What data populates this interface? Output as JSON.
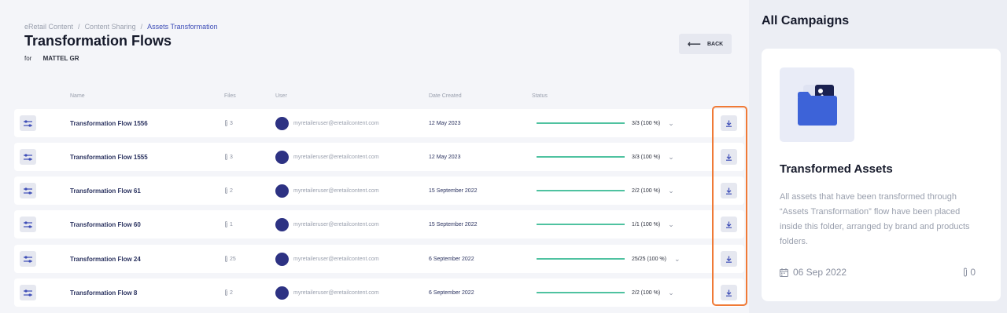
{
  "breadcrumb": [
    "eRetail Content",
    "Content Sharing",
    "Assets Transformation"
  ],
  "page_title": "Transformation Flows",
  "subtitle": {
    "prefix": "for",
    "brand": "MATTEL GR"
  },
  "back_label": "BACK",
  "table_headers": {
    "name": "Name",
    "files": "Files",
    "user": "User",
    "date": "Date Created",
    "status": "Status"
  },
  "rows": [
    {
      "name": "Transformation Flow 1556",
      "files": "3",
      "user": "myretaileruser@eretailcontent.com",
      "date": "12 May 2023",
      "status": "3/3 (100 %)",
      "progress": 1.0
    },
    {
      "name": "Transformation Flow 1555",
      "files": "3",
      "user": "myretaileruser@eretailcontent.com",
      "date": "12 May 2023",
      "status": "3/3 (100 %)",
      "progress": 1.0
    },
    {
      "name": "Transformation Flow 61",
      "files": "2",
      "user": "myretaileruser@eretailcontent.com",
      "date": "15 September 2022",
      "status": "2/2 (100 %)",
      "progress": 1.0
    },
    {
      "name": "Transformation Flow 60",
      "files": "1",
      "user": "myretaileruser@eretailcontent.com",
      "date": "15 September 2022",
      "status": "1/1 (100 %)",
      "progress": 1.0
    },
    {
      "name": "Transformation Flow 24",
      "files": "25",
      "user": "myretaileruser@eretailcontent.com",
      "date": "6 September 2022",
      "status": "25/25 (100 %)",
      "progress": 1.0
    },
    {
      "name": "Transformation Flow 8",
      "files": "2",
      "user": "myretaileruser@eretailcontent.com",
      "date": "6 September 2022",
      "status": "2/2 (100 %)",
      "progress": 1.0
    }
  ],
  "campaigns": {
    "title": "All Campaigns",
    "card": {
      "title": "Transformed Assets",
      "description": "All assets that have been transformed through “Assets Transformation” flow have been placed inside this folder, arranged by brand and products folders.",
      "date": "06 Sep 2022",
      "count": "0"
    }
  },
  "colors": {
    "accent": "#3d4db7",
    "progress": "#4fc2a0",
    "highlight": "#f07a36",
    "avatar": "#2d3283",
    "folder": "#3d63d8"
  },
  "icons": {
    "row_action": "flow-settings-icon",
    "download": "download-icon",
    "files": "paperclip-icon",
    "chevron": "chevron-down-icon",
    "date": "calendar-icon"
  }
}
